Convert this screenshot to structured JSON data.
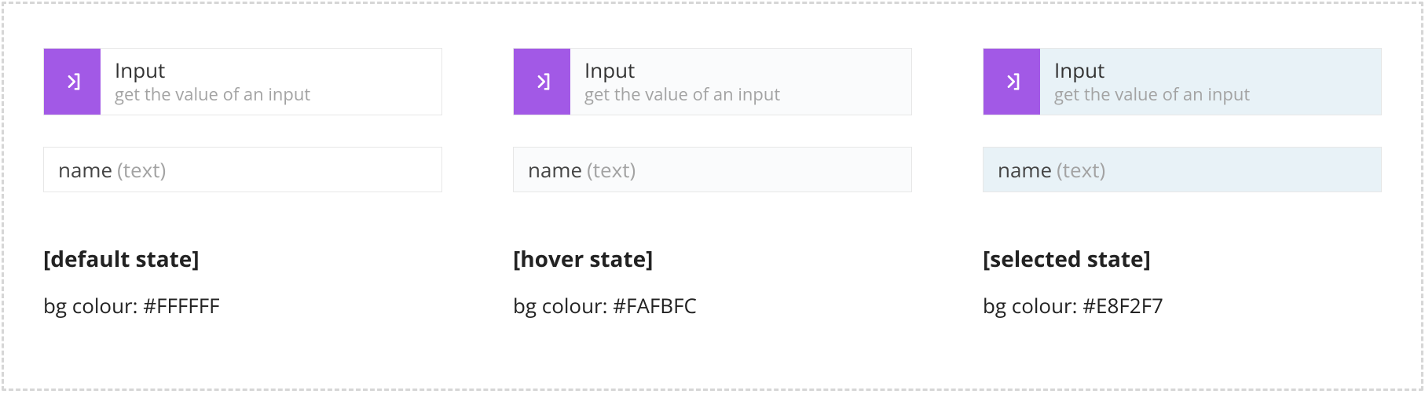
{
  "accent": "#A259E6",
  "columns": [
    {
      "state_label": "[default state]",
      "bg_text": "bg colour: #FFFFFF",
      "bg_color": "#FFFFFF",
      "card": {
        "title": "Input",
        "subtitle": "get the value of an input"
      },
      "field": {
        "name": "name",
        "type": "(text)"
      }
    },
    {
      "state_label": "[hover state]",
      "bg_text": "bg colour: #FAFBFC",
      "bg_color": "#FAFBFC",
      "card": {
        "title": "Input",
        "subtitle": "get the value of an input"
      },
      "field": {
        "name": "name",
        "type": "(text)"
      }
    },
    {
      "state_label": "[selected state]",
      "bg_text": "bg colour: #E8F2F7",
      "bg_color": "#E8F2F7",
      "card": {
        "title": "Input",
        "subtitle": "get the value of an input"
      },
      "field": {
        "name": "name",
        "type": "(text)"
      }
    }
  ]
}
